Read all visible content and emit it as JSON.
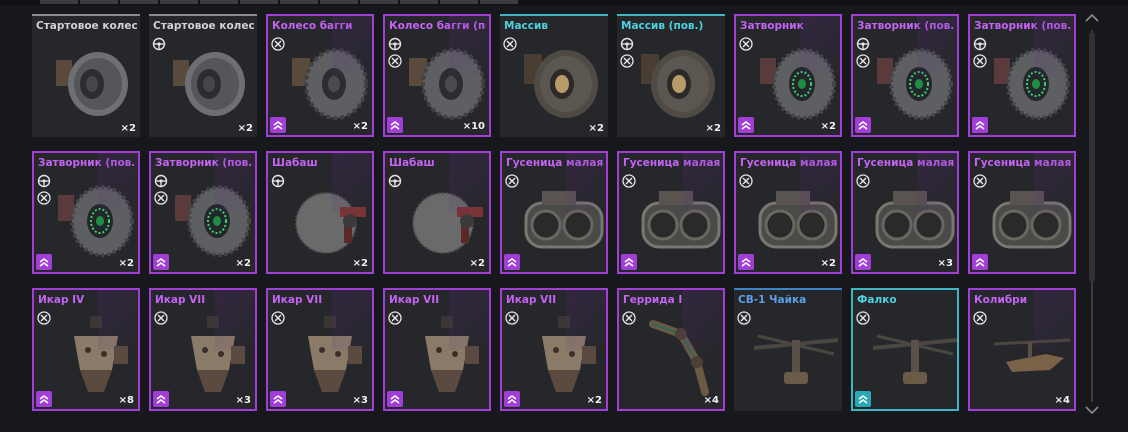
{
  "items": [
    {
      "name": "Стартовое колесо",
      "rarity": "grey",
      "icons": [],
      "count": "×2",
      "kind": "wheel",
      "badge": false
    },
    {
      "name": "Стартовое колесо (пов.)",
      "rarity": "grey",
      "icons": [
        "steering-icon"
      ],
      "count": "×2",
      "kind": "wheel",
      "badge": false
    },
    {
      "name": "Колесо багги",
      "rarity": "purple",
      "icons": [
        "wrench-icon"
      ],
      "count": "×2",
      "kind": "wheel-offroad",
      "badge": true
    },
    {
      "name": "Колесо багги (пов.)",
      "rarity": "purple",
      "icons": [
        "steering-icon",
        "wrench-icon"
      ],
      "count": "×10",
      "kind": "wheel-offroad",
      "badge": true
    },
    {
      "name": "Массив",
      "rarity": "cyan",
      "icons": [
        "wrench-icon"
      ],
      "count": "×2",
      "kind": "wheel-big",
      "badge": false
    },
    {
      "name": "Массив (пов.)",
      "rarity": "cyan",
      "icons": [
        "steering-icon",
        "wrench-icon"
      ],
      "count": "×2",
      "kind": "wheel-big",
      "badge": false
    },
    {
      "name": "Затворник",
      "rarity": "purple",
      "icons": [
        "wrench-icon"
      ],
      "count": "×2",
      "kind": "wheel-green",
      "badge": true
    },
    {
      "name": "Затворник (пов.)",
      "rarity": "purple",
      "icons": [
        "steering-icon",
        "wrench-icon"
      ],
      "count": "",
      "kind": "wheel-green",
      "badge": true
    },
    {
      "name": "Затворник (пов.)",
      "rarity": "purple",
      "icons": [
        "steering-icon",
        "wrench-icon"
      ],
      "count": "",
      "kind": "wheel-green",
      "badge": true
    },
    {
      "name": "Затворник (пов.)",
      "rarity": "purple",
      "icons": [
        "steering-icon",
        "wrench-icon"
      ],
      "count": "×2",
      "kind": "wheel-green",
      "badge": true
    },
    {
      "name": "Затворник (пов.)",
      "rarity": "purple",
      "icons": [
        "steering-icon",
        "wrench-icon"
      ],
      "count": "×2",
      "kind": "wheel-green",
      "badge": true
    },
    {
      "name": "Шабаш",
      "rarity": "purple",
      "icons": [
        "steering-icon"
      ],
      "count": "×2",
      "kind": "wheel-ball",
      "badge": false
    },
    {
      "name": "Шабаш",
      "rarity": "purple",
      "icons": [
        "steering-icon"
      ],
      "count": "×2",
      "kind": "wheel-ball",
      "badge": false
    },
    {
      "name": "Гусеница малая",
      "rarity": "purple",
      "icons": [
        "wrench-icon"
      ],
      "count": "",
      "kind": "track",
      "badge": true
    },
    {
      "name": "Гусеница малая",
      "rarity": "purple",
      "icons": [
        "wrench-icon"
      ],
      "count": "",
      "kind": "track",
      "badge": true
    },
    {
      "name": "Гусеница малая",
      "rarity": "purple",
      "icons": [
        "wrench-icon"
      ],
      "count": "×2",
      "kind": "track",
      "badge": true
    },
    {
      "name": "Гусеница малая",
      "rarity": "purple",
      "icons": [
        "wrench-icon"
      ],
      "count": "×3",
      "kind": "track",
      "badge": true
    },
    {
      "name": "Гусеница малая",
      "rarity": "purple",
      "icons": [
        "wrench-icon"
      ],
      "count": "",
      "kind": "track",
      "badge": true
    },
    {
      "name": "Икар IV",
      "rarity": "purple",
      "icons": [
        "wrench-icon"
      ],
      "count": "×8",
      "kind": "thruster",
      "badge": true
    },
    {
      "name": "Икар VII",
      "rarity": "purple",
      "icons": [
        "wrench-icon"
      ],
      "count": "×3",
      "kind": "thruster",
      "badge": true
    },
    {
      "name": "Икар VII",
      "rarity": "purple",
      "icons": [
        "wrench-icon"
      ],
      "count": "×3",
      "kind": "thruster",
      "badge": true
    },
    {
      "name": "Икар VII",
      "rarity": "purple",
      "icons": [
        "wrench-icon"
      ],
      "count": "",
      "kind": "thruster",
      "badge": true
    },
    {
      "name": "Икар VII",
      "rarity": "purple",
      "icons": [
        "wrench-icon"
      ],
      "count": "×2",
      "kind": "thruster",
      "badge": true
    },
    {
      "name": "Геррида I",
      "rarity": "purple",
      "icons": [
        "wrench-icon"
      ],
      "count": "×4",
      "kind": "leg",
      "badge": false
    },
    {
      "name": "СВ-1 Чайка",
      "rarity": "blue",
      "icons": [
        "wrench-icon"
      ],
      "count": "",
      "kind": "rotor",
      "badge": false
    },
    {
      "name": "Фалко",
      "rarity": "cyanbox",
      "icons": [
        "wrench-icon"
      ],
      "count": "",
      "kind": "rotor",
      "badge": true
    },
    {
      "name": "Колибри",
      "rarity": "purple",
      "icons": [
        "wrench-icon"
      ],
      "count": "×4",
      "kind": "heli",
      "badge": false
    }
  ]
}
